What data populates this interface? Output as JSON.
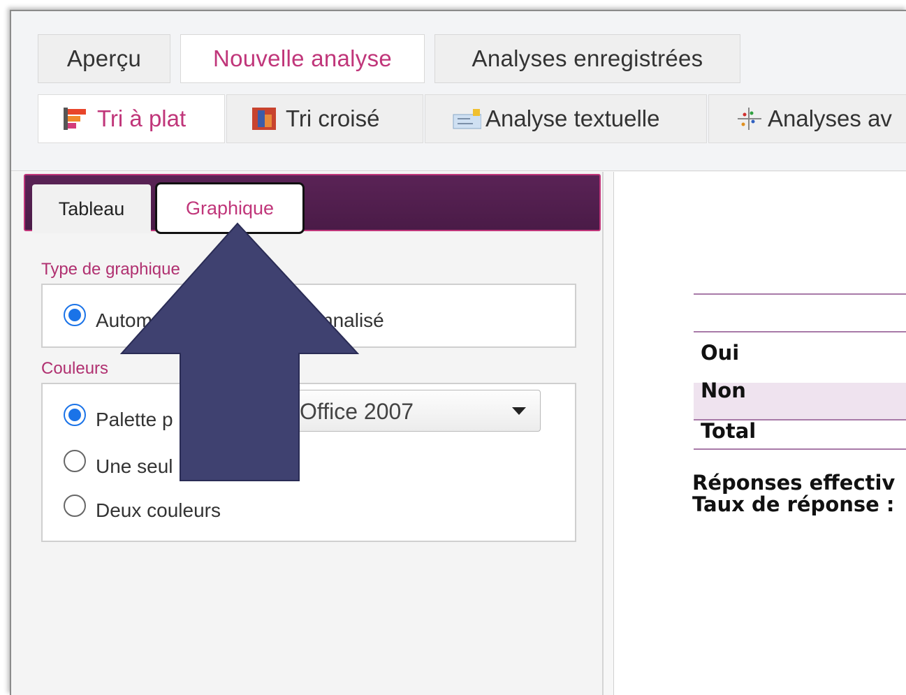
{
  "main_tabs": [
    {
      "label": "Aperçu",
      "active": false
    },
    {
      "label": "Nouvelle analyse",
      "active": true
    },
    {
      "label": "Analyses enregistrées",
      "active": false
    }
  ],
  "sub_tabs": [
    {
      "label": "Tri à plat",
      "icon": "flat-sort-icon",
      "active": true
    },
    {
      "label": "Tri croisé",
      "icon": "cross-tab-icon",
      "active": false
    },
    {
      "label": "Analyse textuelle",
      "icon": "text-analysis-icon",
      "active": false
    },
    {
      "label": "Analyses av",
      "icon": "advanced-analysis-icon",
      "active": false
    }
  ],
  "panel_tabs": [
    {
      "label": "Tableau",
      "active": false
    },
    {
      "label": "Graphique",
      "active": true
    }
  ],
  "chart_type": {
    "section_label": "Type de graphique",
    "options": [
      {
        "label": "Automa",
        "checked": true
      },
      {
        "label": "nnalisé",
        "checked": false
      }
    ]
  },
  "colors": {
    "section_label": "Couleurs",
    "options": [
      {
        "label": "Palette p",
        "checked": true
      },
      {
        "label": "Une seul",
        "checked": false
      },
      {
        "label": "Deux couleurs",
        "checked": false
      }
    ],
    "palette_select": {
      "value": "Office 2007"
    }
  },
  "results": {
    "rows": [
      "Oui",
      "Non",
      "Total"
    ],
    "responses_line": "Réponses effectiv",
    "rate_line": "Taux de réponse :"
  },
  "annotation": {
    "icon": "up-arrow-icon",
    "color": "#3f4170"
  },
  "theme": {
    "accent": "#c0367a",
    "panel_header": "#4a1b47"
  }
}
